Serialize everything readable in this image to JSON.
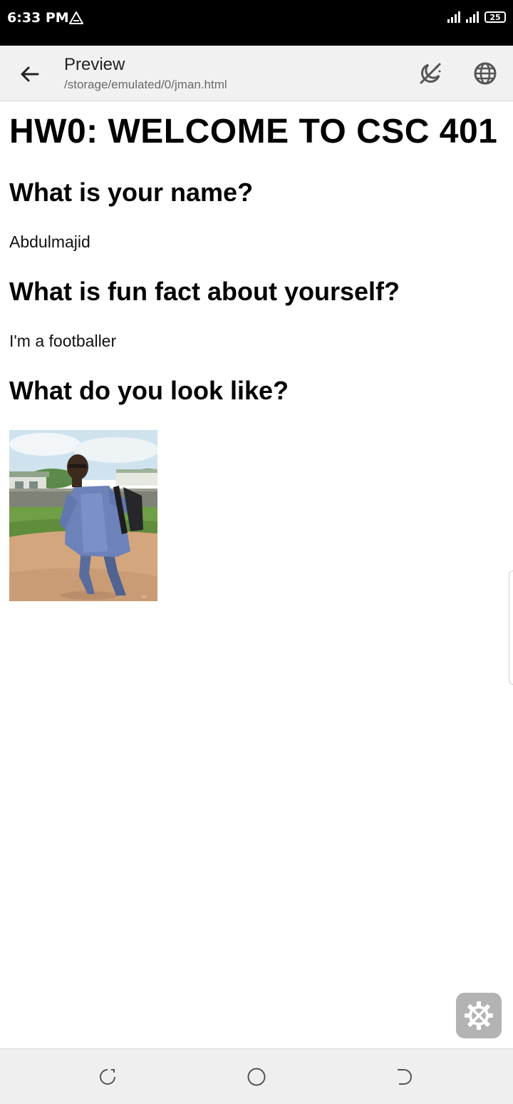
{
  "status_bar": {
    "time": "6:33 PM",
    "battery": "25",
    "icons": [
      "warning-triangle-icon",
      "signal-icon",
      "signal-icon",
      "battery-icon"
    ]
  },
  "app_bar": {
    "title": "Preview",
    "subtitle": "/storage/emulated/0/jman.html",
    "icons": [
      "back-arrow-icon",
      "night-mode-icon",
      "globe-icon"
    ]
  },
  "content": {
    "heading": "HW0: WELCOME TO CSC 401",
    "q_name": "What is your name?",
    "a_name": "Abdulmajid",
    "q_fact": "What is fun fact about yourself?",
    "a_fact": "I'm a footballer",
    "q_look": "What do you look like?"
  },
  "floating": {
    "icon": "settings-tools-icon"
  },
  "nav_bar": {
    "icons": [
      "recents-icon",
      "home-icon",
      "back-icon"
    ]
  },
  "colors": {
    "status_bar": "#000000",
    "app_bar": "#f1f1f1",
    "fab": "#b3b3b3"
  }
}
